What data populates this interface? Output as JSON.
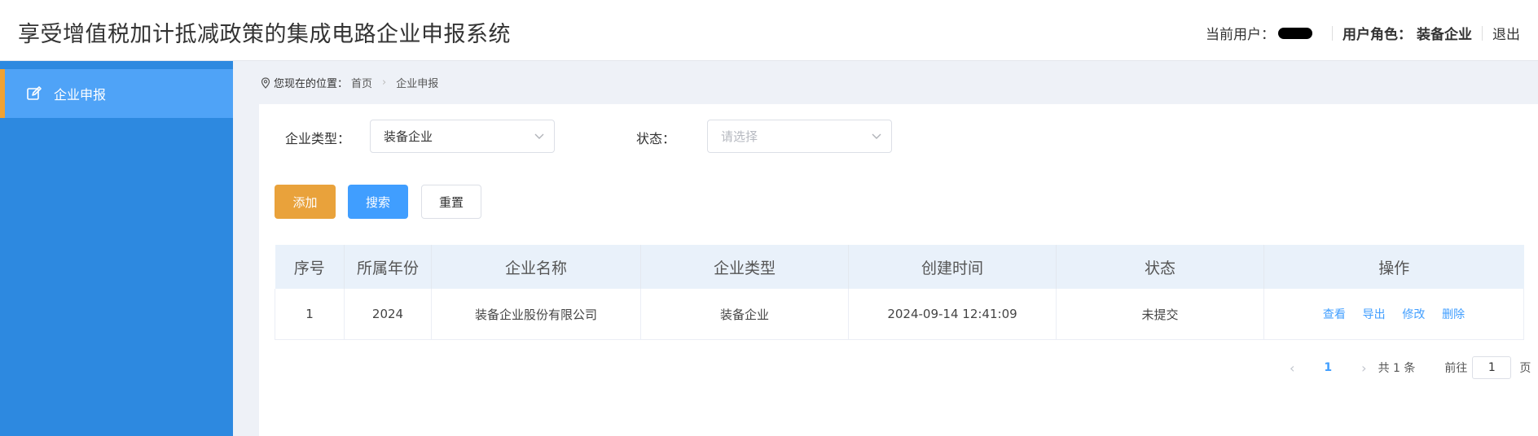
{
  "header": {
    "title": "享受增值税加计抵减政策的集成电路企业申报系统",
    "current_user_label": "当前用户：",
    "role_label": "用户角色：",
    "role_value": "装备企业",
    "logout_label": "退出"
  },
  "sidebar": {
    "items": [
      {
        "label": "企业申报",
        "icon": "edit-icon"
      }
    ]
  },
  "breadcrumb": {
    "prefix": "您现在的位置：",
    "home": "首页",
    "current": "企业申报"
  },
  "filters": {
    "enterprise_type_label": "企业类型：",
    "enterprise_type_value": "装备企业",
    "status_label": "状态：",
    "status_placeholder": "请选择"
  },
  "buttons": {
    "add": "添加",
    "search": "搜索",
    "reset": "重置"
  },
  "table": {
    "headers": [
      "序号",
      "所属年份",
      "企业名称",
      "企业类型",
      "创建时间",
      "状态",
      "操作"
    ],
    "rows": [
      {
        "index": "1",
        "year": "2024",
        "name": "装备企业股份有限公司",
        "type": "装备企业",
        "created": "2024-09-14 12:41:09",
        "status": "未提交",
        "actions": [
          "查看",
          "导出",
          "修改",
          "删除"
        ]
      }
    ]
  },
  "pagination": {
    "current_page": "1",
    "total_text": "共 1 条",
    "goto_label": "前往",
    "goto_value": "1",
    "page_suffix": "页"
  },
  "colors": {
    "sidebar": "#2d89e0",
    "sidebar_active": "#4fa3f7",
    "active_marker": "#f0a233",
    "primary": "#409eff",
    "warning": "#e9a23b"
  }
}
